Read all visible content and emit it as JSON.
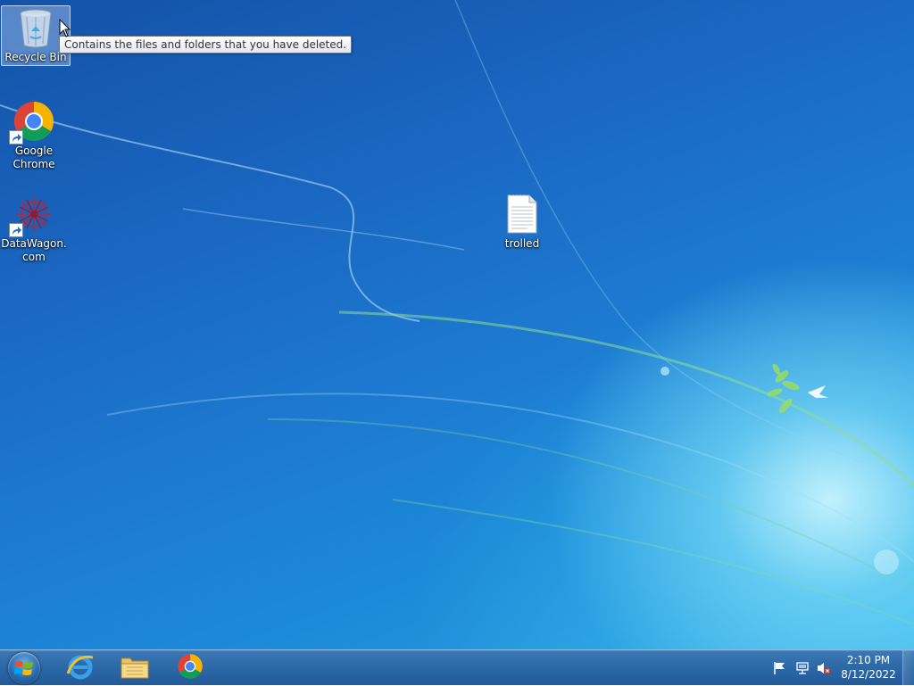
{
  "desktop": {
    "icons": [
      {
        "label": "Recycle Bin",
        "icon": "recycle-bin-icon",
        "selected": true
      },
      {
        "label": "Google Chrome",
        "icon": "chrome-icon"
      },
      {
        "label": "DataWagon.com",
        "icon": "datawagon-icon"
      },
      {
        "label": "trolled",
        "icon": "text-file-icon"
      }
    ],
    "tooltip": "Contains the files and folders that you have deleted."
  },
  "taskbar": {
    "start": "windows-logo-icon",
    "pinned": [
      "internet-explorer-icon",
      "file-explorer-icon",
      "chrome-icon"
    ],
    "tray": [
      "action-center-flag-icon",
      "network-icon",
      "volume-muted-icon"
    ],
    "clock": {
      "time": "2:10 PM",
      "date": "8/12/2022"
    }
  },
  "colors": {
    "taskbar": "#2c68a6",
    "wallpaper_dark": "#1452a8",
    "wallpaper_light": "#c8f5ff"
  }
}
